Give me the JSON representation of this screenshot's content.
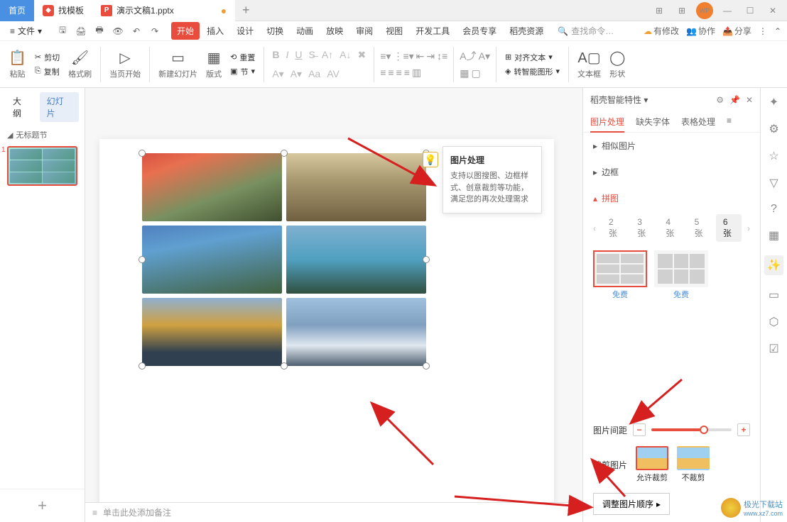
{
  "titlebar": {
    "home": "首页",
    "template": "找模板",
    "filename": "演示文稿1.pptx"
  },
  "menubar": {
    "file": "文件",
    "tabs": [
      "开始",
      "插入",
      "设计",
      "切换",
      "动画",
      "放映",
      "审阅",
      "视图",
      "开发工具",
      "会员专享",
      "稻壳资源"
    ],
    "search": "查找命令…",
    "right": {
      "pending": "有修改",
      "collab": "协作",
      "share": "分享"
    }
  },
  "ribbon": {
    "paste": "粘贴",
    "cut": "剪切",
    "copy": "复制",
    "format_painter": "格式刷",
    "from_current": "当页开始",
    "new_slide": "新建幻灯片",
    "layout": "版式",
    "section": "节",
    "reset": "重置",
    "align_text": "对齐文本",
    "convert_smart": "转智能图形",
    "text_box": "文本框",
    "shapes": "形状"
  },
  "left_panel": {
    "outline": "大纲",
    "slides": "幻灯片",
    "untitled_section": "无标题节"
  },
  "tooltip": {
    "title": "图片处理",
    "body": "支持以图搜图、边框样式、创意裁剪等功能，满足您的再次处理需求"
  },
  "notes": "单击此处添加备注",
  "right_panel": {
    "title": "稻壳智能特性",
    "tabs": {
      "image": "图片处理",
      "missing_fonts": "缺失字体",
      "table": "表格处理"
    },
    "sections": {
      "similar": "相似图片",
      "border": "边框",
      "collage": "拼图"
    },
    "counts": [
      "2张",
      "3张",
      "4张",
      "5张",
      "6张"
    ],
    "free": "免费",
    "spacing_label": "图片间距",
    "crop_label": "裁剪图片",
    "crop_allow": "允许裁剪",
    "crop_disallow": "不裁剪",
    "adjust_order": "调整图片顺序"
  },
  "watermark": {
    "site": "极光下载站",
    "url": "www.xz7.com"
  }
}
